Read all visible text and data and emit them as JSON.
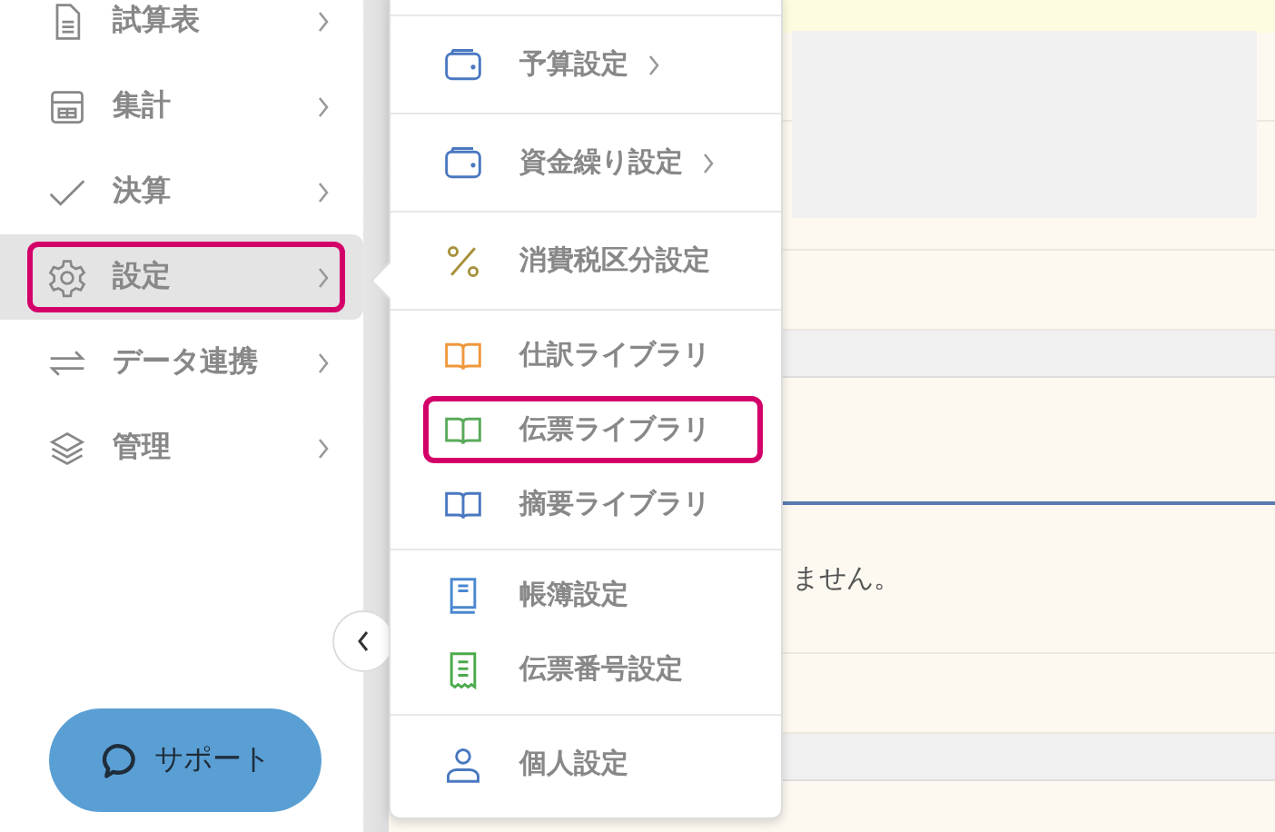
{
  "sidebar": {
    "items": [
      {
        "label": "試算表",
        "kind": "document",
        "selected": false,
        "highlighted": false
      },
      {
        "label": "集計",
        "kind": "calculator",
        "selected": false,
        "highlighted": false
      },
      {
        "label": "決算",
        "kind": "check",
        "selected": false,
        "highlighted": false
      },
      {
        "label": "設定",
        "kind": "gear",
        "selected": true,
        "highlighted": true
      },
      {
        "label": "データ連携",
        "kind": "arrows",
        "selected": false,
        "highlighted": false
      },
      {
        "label": "管理",
        "kind": "layers",
        "selected": false,
        "highlighted": false
      }
    ]
  },
  "support_button": {
    "label": "サポート"
  },
  "settings_menu": {
    "sections": [
      {
        "items": [
          {
            "label": "予算設定",
            "kind": "wallet",
            "color": "#4a78c0",
            "submenu": true,
            "highlighted": false
          }
        ]
      },
      {
        "items": [
          {
            "label": "資金繰り設定",
            "kind": "wallet",
            "color": "#4a78c0",
            "submenu": true,
            "highlighted": false
          }
        ]
      },
      {
        "items": [
          {
            "label": "消費税区分設定",
            "kind": "percent",
            "color": "#a8913c",
            "submenu": false,
            "highlighted": false
          }
        ]
      },
      {
        "items": [
          {
            "label": "仕訳ライブラリ",
            "kind": "book",
            "color": "#f0983c",
            "submenu": false,
            "highlighted": false
          },
          {
            "label": "伝票ライブラリ",
            "kind": "book",
            "color": "#5aaa5a",
            "submenu": false,
            "highlighted": true
          },
          {
            "label": "摘要ライブラリ",
            "kind": "book",
            "color": "#4a78c0",
            "submenu": false,
            "highlighted": false
          }
        ]
      },
      {
        "items": [
          {
            "label": "帳簿設定",
            "kind": "ledger",
            "color": "#4a88d0",
            "submenu": false,
            "highlighted": false
          },
          {
            "label": "伝票番号設定",
            "kind": "receipt",
            "color": "#4caa4c",
            "submenu": false,
            "highlighted": false
          }
        ]
      },
      {
        "items": [
          {
            "label": "個人設定",
            "kind": "person",
            "color": "#4a78c0",
            "submenu": false,
            "highlighted": false
          }
        ]
      }
    ]
  },
  "content": {
    "message": "ません。"
  }
}
